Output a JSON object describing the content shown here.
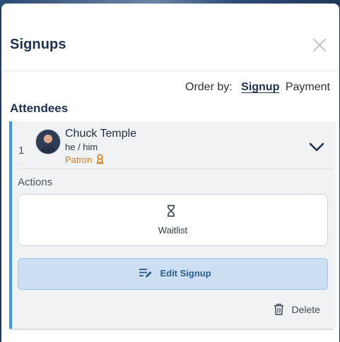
{
  "modal": {
    "title": "Signups",
    "close_icon": "close-icon"
  },
  "order_by": {
    "label": "Order by:",
    "options": [
      {
        "label": "Signup",
        "active": true
      },
      {
        "label": "Payment",
        "active": false
      }
    ]
  },
  "attendees": {
    "title": "Attendees",
    "items": [
      {
        "rank": "1",
        "name": "Chuck Temple",
        "pronouns": "he / him",
        "badge": "Patron",
        "badge_icon": "ribbon-icon",
        "badge_color": "#d07c1f",
        "expand_icon": "chevron-down-icon",
        "actions_label": "Actions",
        "waitlist_label": "Waitlist",
        "waitlist_icon": "hourglass-icon",
        "edit_label": "Edit Signup",
        "edit_icon": "edit-list-icon",
        "delete_label": "Delete",
        "delete_icon": "trash-icon",
        "accent_color": "#3e95ea"
      }
    ]
  }
}
